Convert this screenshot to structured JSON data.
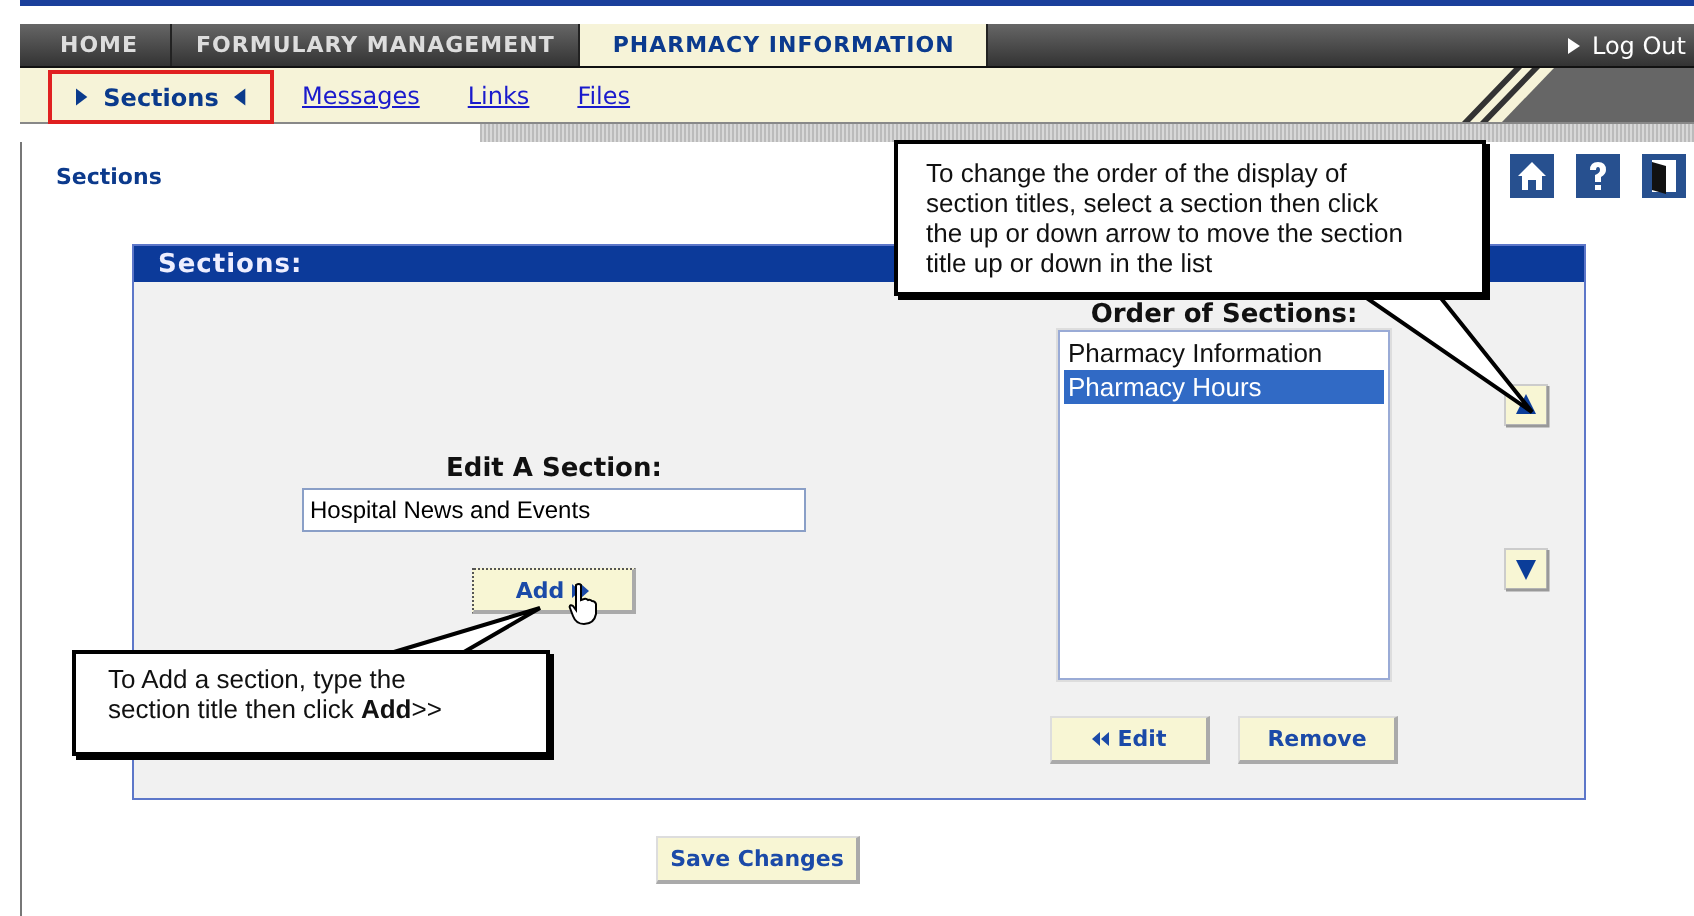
{
  "tabs": [
    {
      "label": "HOME",
      "selected": false
    },
    {
      "label": "FORMULARY MANAGEMENT",
      "selected": false
    },
    {
      "label": "PHARMACY INFORMATION",
      "selected": true
    }
  ],
  "logout": "Log Out",
  "subnav": [
    {
      "label": "Sections",
      "selected": true
    },
    {
      "label": "Messages",
      "selected": false
    },
    {
      "label": "Links",
      "selected": false
    },
    {
      "label": "Files",
      "selected": false
    }
  ],
  "page_title": "Sections",
  "panel": {
    "title": "Sections:",
    "edit_label": "Edit A Section:",
    "edit_value": "Hospital News and Events",
    "add_button": "Add",
    "order_label": "Order of Sections:",
    "sections": [
      {
        "label": "Pharmacy Information",
        "selected": false
      },
      {
        "label": "Pharmacy Hours",
        "selected": true
      }
    ],
    "edit_button": "Edit",
    "remove_button": "Remove"
  },
  "save_button": "Save Changes",
  "callouts": [
    "To change the order of the display of section titles, select a section then click the up or down arrow to move the section title up or down in the list",
    "To Add a section, type the section title then click **Add**>>"
  ]
}
